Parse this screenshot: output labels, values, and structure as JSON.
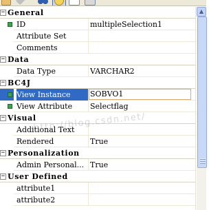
{
  "toolbar": {
    "icons": [
      "categorized-icon",
      "sort-icon",
      "view-icon",
      "properties-icon",
      "events-icon",
      "grid-icon"
    ]
  },
  "categories": [
    {
      "label": "General",
      "expanded": true,
      "properties": [
        {
          "name": "ID",
          "value": "multipleSelection1",
          "has_icon": true
        },
        {
          "name": "Attribute Set",
          "value": "",
          "has_icon": false
        },
        {
          "name": "Comments",
          "value": "",
          "has_icon": false
        }
      ]
    },
    {
      "label": "Data",
      "expanded": true,
      "properties": [
        {
          "name": "Data Type",
          "value": "VARCHAR2",
          "has_icon": false
        }
      ]
    },
    {
      "label": "BC4J",
      "expanded": true,
      "properties": [
        {
          "name": "View Instance",
          "value": "SOBVO1",
          "has_icon": true,
          "selected": true
        },
        {
          "name": "View Attribute",
          "value": "Selectflag",
          "has_icon": true
        }
      ]
    },
    {
      "label": "Visual",
      "expanded": true,
      "properties": [
        {
          "name": "Additional Text",
          "value": "",
          "has_icon": false
        },
        {
          "name": "Rendered",
          "value": "True",
          "has_icon": false
        }
      ]
    },
    {
      "label": "Personalization",
      "expanded": true,
      "properties": [
        {
          "name": "Admin Personal...",
          "value": "True",
          "has_icon": false
        }
      ]
    },
    {
      "label": "User Defined",
      "expanded": true,
      "properties": [
        {
          "name": "attribute1",
          "value": "",
          "has_icon": false
        },
        {
          "name": "attribute2",
          "value": "",
          "has_icon": false
        }
      ]
    }
  ],
  "toggle_symbol": "−",
  "watermark_text": "http://blog.csdn.net/",
  "colors": {
    "selection": "#316ac5",
    "property_icon": "#3aa54a",
    "editor_border": "#d4b070"
  }
}
